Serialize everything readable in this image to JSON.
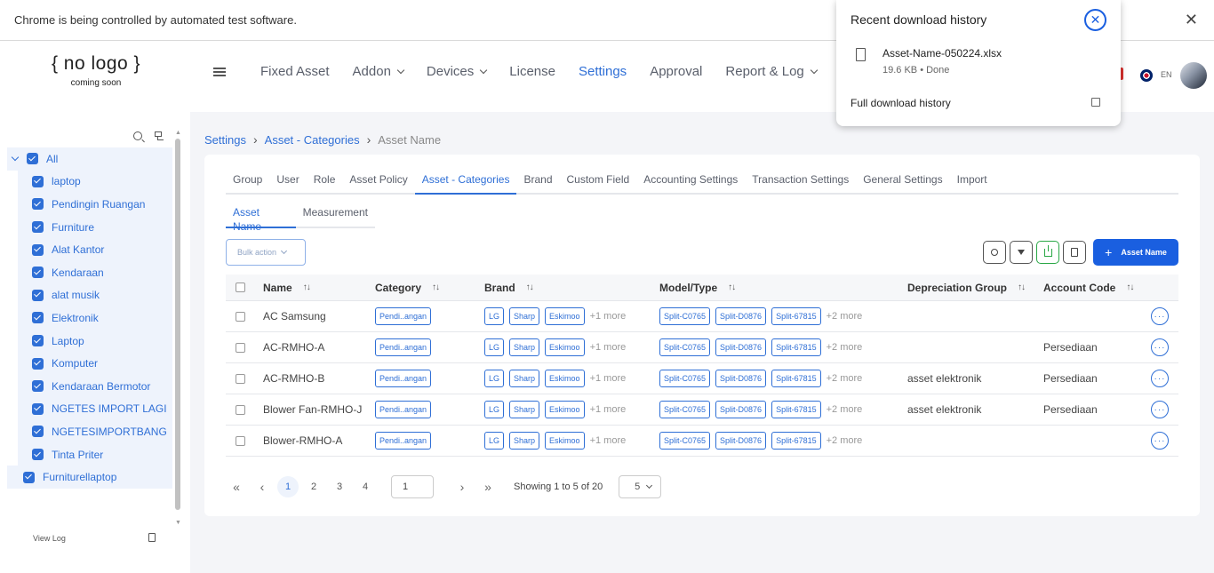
{
  "browser": {
    "automation_notice": "Chrome is being controlled by automated test software.",
    "close_glyph": "✕"
  },
  "header": {
    "logo_main": "{ no logo }",
    "logo_sub": "coming soon",
    "nav": [
      {
        "label": "Fixed Asset",
        "dropdown": false,
        "active": false
      },
      {
        "label": "Addon",
        "dropdown": true,
        "active": false
      },
      {
        "label": "Devices",
        "dropdown": true,
        "active": false
      },
      {
        "label": "License",
        "dropdown": false,
        "active": false
      },
      {
        "label": "Settings",
        "dropdown": false,
        "active": true
      },
      {
        "label": "Approval",
        "dropdown": false,
        "active": false
      },
      {
        "label": "Report & Log",
        "dropdown": true,
        "active": false
      }
    ],
    "language": "EN"
  },
  "sidebar": {
    "tree_items": [
      "All",
      "laptop",
      "Pendingin Ruangan",
      "Furniture",
      "Alat Kantor",
      "Kendaraan",
      "alat musik",
      "Elektronik",
      "Laptop",
      "Komputer",
      "Kendaraan Bermotor",
      "NGETES IMPORT LAGI",
      "NGETESIMPORTBANG",
      "Tinta Priter",
      "Furniturellaptop"
    ],
    "view_log": "View Log"
  },
  "breadcrumb": [
    "Settings",
    "Asset - Categories",
    "Asset Name"
  ],
  "tabs": [
    "Group",
    "User",
    "Role",
    "Asset Policy",
    "Asset - Categories",
    "Brand",
    "Custom Field",
    "Accounting Settings",
    "Transaction Settings",
    "General Settings",
    "Import"
  ],
  "active_tab": "Asset - Categories",
  "subtabs": [
    "Asset Name",
    "Measurement"
  ],
  "active_subtab": "Asset Name",
  "toolbar": {
    "bulk_action": "Bulk action",
    "add_button": "Asset Name",
    "add_glyph": "+"
  },
  "table": {
    "columns": [
      "Name",
      "Category",
      "Brand",
      "Model/Type",
      "Depreciation Group",
      "Account Code"
    ],
    "sort_glyph": "↑↓",
    "rows": [
      {
        "name": "AC Samsung",
        "category": "Pendi..angan",
        "brands": [
          "LG",
          "Sharp",
          "Eskimoo"
        ],
        "brand_more": "+1 more",
        "models": [
          "Split-C0765",
          "Split-D0876",
          "Split-67815"
        ],
        "model_more": "+2 more",
        "dep_group": "",
        "account_code": ""
      },
      {
        "name": "AC-RMHO-A",
        "category": "Pendi..angan",
        "brands": [
          "LG",
          "Sharp",
          "Eskimoo"
        ],
        "brand_more": "+1 more",
        "models": [
          "Split-C0765",
          "Split-D0876",
          "Split-67815"
        ],
        "model_more": "+2 more",
        "dep_group": "",
        "account_code": "Persediaan"
      },
      {
        "name": "AC-RMHO-B",
        "category": "Pendi..angan",
        "brands": [
          "LG",
          "Sharp",
          "Eskimoo"
        ],
        "brand_more": "+1 more",
        "models": [
          "Split-C0765",
          "Split-D0876",
          "Split-67815"
        ],
        "model_more": "+2 more",
        "dep_group": "asset elektronik",
        "account_code": "Persediaan"
      },
      {
        "name": "Blower Fan-RMHO-J",
        "category": "Pendi..angan",
        "brands": [
          "LG",
          "Sharp",
          "Eskimoo"
        ],
        "brand_more": "+1 more",
        "models": [
          "Split-C0765",
          "Split-D0876",
          "Split-67815"
        ],
        "model_more": "+2 more",
        "dep_group": "asset elektronik",
        "account_code": "Persediaan"
      },
      {
        "name": "Blower-RMHO-A",
        "category": "Pendi..angan",
        "brands": [
          "LG",
          "Sharp",
          "Eskimoo"
        ],
        "brand_more": "+1 more",
        "models": [
          "Split-C0765",
          "Split-D0876",
          "Split-67815"
        ],
        "model_more": "+2 more",
        "dep_group": "",
        "account_code": ""
      }
    ],
    "row_menu_glyph": "···"
  },
  "pagination": {
    "first": "«",
    "prev": "‹",
    "pages": [
      "1",
      "2",
      "3",
      "4"
    ],
    "current_page": "1",
    "page_input": "1",
    "next": "›",
    "last": "»",
    "showing": "Showing 1 to 5 of 20",
    "per_page": "5"
  },
  "download_popup": {
    "title": "Recent download history",
    "close_glyph": "✕",
    "file_name": "Asset-Name-050224.xlsx",
    "file_status": "19.6 KB • Done",
    "full_history": "Full download history"
  },
  "colors": {
    "accent": "#2f6fd6",
    "primary_button": "#1a5fe0",
    "download_green": "#28a745"
  },
  "icons": [
    "hamburger-icon",
    "search-icon",
    "tree-icon",
    "file-icon",
    "external-link-icon",
    "filter-icon",
    "download-icon",
    "document-icon",
    "close-icon",
    "flag-icon"
  ]
}
